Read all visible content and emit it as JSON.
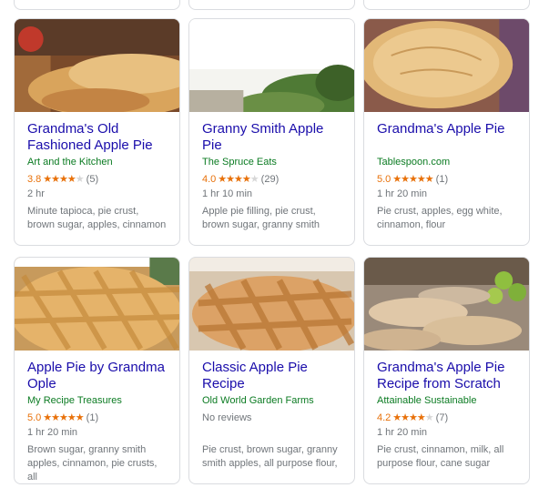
{
  "colors": {
    "title": "#1a0dab",
    "source": "#0b7b22",
    "rating": "#e8710a",
    "meta": "#70757a"
  },
  "recipes": [
    {
      "title": "Grandma's Old Fashioned Apple Pie",
      "source": "Art and the Kitchen",
      "rating": "3.8",
      "stars": 3.8,
      "reviews": "(5)",
      "time": "2 hr",
      "ingredients": "Minute tapioca, pie crust, brown sugar, apples, cinnamon",
      "image_icon": "apple-pie-photo"
    },
    {
      "title": "Granny Smith Apple Pie",
      "source": "The Spruce Eats",
      "rating": "4.0",
      "stars": 4.0,
      "reviews": "(29)",
      "time": "1 hr 10 min",
      "ingredients": "Apple pie filling, pie crust, brown sugar, granny smith",
      "image_icon": "apple-pie-photo"
    },
    {
      "title": "Grandma's Apple Pie",
      "source": "Tablespoon.com",
      "rating": "5.0",
      "stars": 5.0,
      "reviews": "(1)",
      "time": "1 hr 20 min",
      "ingredients": "Pie crust, apples, egg white, cinnamon, flour",
      "image_icon": "apple-pie-photo"
    },
    {
      "title": "Apple Pie by Grandma Ople",
      "source": "My Recipe Treasures",
      "rating": "5.0",
      "stars": 5.0,
      "reviews": "(1)",
      "time": "1 hr 20 min",
      "ingredients": "Brown sugar, granny smith apples, cinnamon, pie crusts, all",
      "image_icon": "apple-pie-photo"
    },
    {
      "title": "Classic Apple Pie Recipe",
      "source": "Old World Garden Farms",
      "no_reviews": "No reviews",
      "ingredients": "Pie crust, brown sugar, granny smith apples, all purpose flour,",
      "image_icon": "apple-pie-photo"
    },
    {
      "title": "Grandma's Apple Pie Recipe from Scratch",
      "source": "Attainable Sustainable",
      "rating": "4.2",
      "stars": 4.2,
      "reviews": "(7)",
      "time": "1 hr 20 min",
      "ingredients": "Pie crust, cinnamon, milk, all purpose flour, cane sugar",
      "image_icon": "apple-pie-photo"
    }
  ]
}
